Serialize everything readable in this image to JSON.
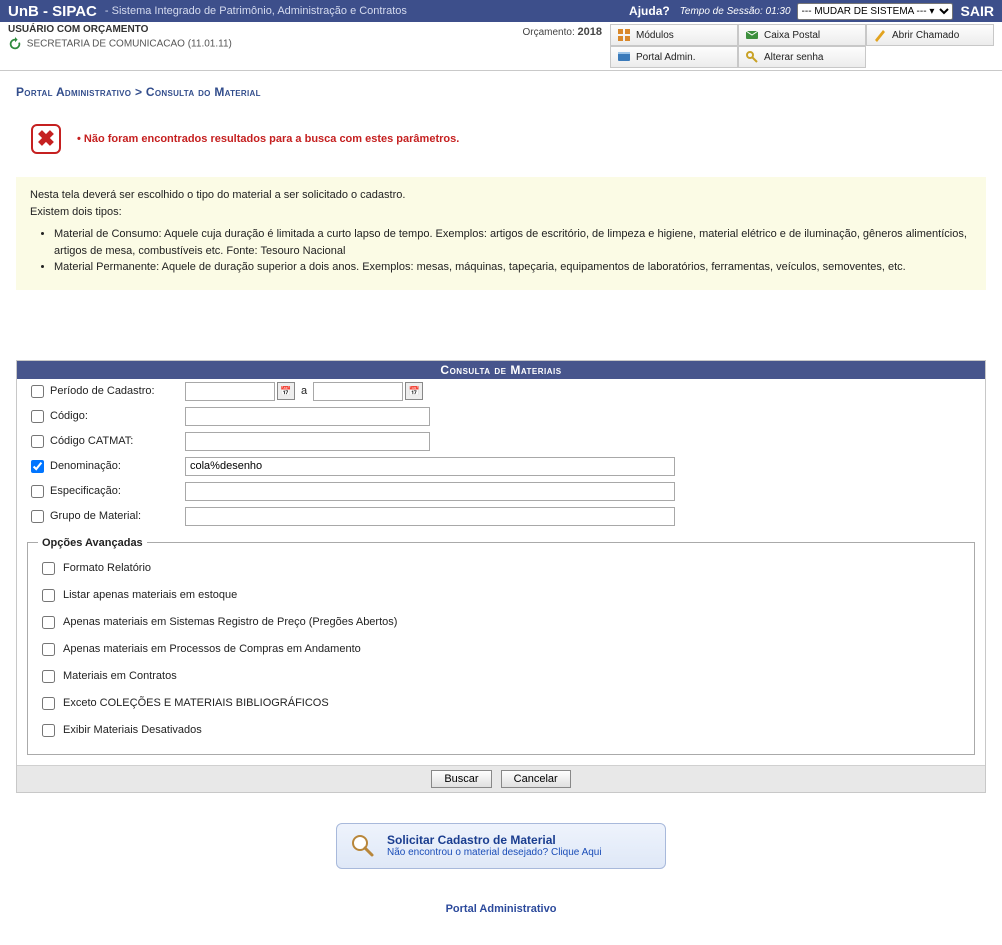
{
  "topbar": {
    "brand": "UnB - SIPAC",
    "subtitle": "- Sistema Integrado de Patrimônio, Administração e Contratos",
    "help": "Ajuda?",
    "session_label": "Tempo de Sessão:",
    "session_time": "01:30",
    "system_select": "--- MUDAR DE SISTEMA --- ▾",
    "logout": "SAIR"
  },
  "subheader": {
    "user_line": "USUÁRIO COM ORÇAMENTO",
    "dept": "SECRETARIA DE COMUNICACAO (11.01.11)",
    "orcamento_label": "Orçamento:",
    "orcamento_year": "2018"
  },
  "shortcuts": {
    "modulos": "Módulos",
    "caixa": "Caixa Postal",
    "chamado": "Abrir Chamado",
    "portal": "Portal Admin.",
    "senha": "Alterar senha"
  },
  "breadcrumb": "Portal Administrativo > Consulta do Material",
  "alert": "Não foram encontrados resultados para a busca com estes parâmetros.",
  "info": {
    "p1": "Nesta tela deverá ser escolhido o tipo do material a ser solicitado o cadastro.",
    "p2": "Existem dois tipos:",
    "li1": "Material de Consumo: Aquele cuja duração é limitada a curto lapso de tempo. Exemplos: artigos de escritório, de limpeza e higiene, material elétrico e de iluminação, gêneros alimentícios, artigos de mesa, combustíveis etc. Fonte: Tesouro Nacional",
    "li2": "Material Permanente: Aquele de duração superior a dois anos. Exemplos: mesas, máquinas, tapeçaria, equipamentos de laboratórios, ferramentas, veículos, semoventes, etc."
  },
  "panel": {
    "title": "Consulta de Materiais",
    "labels": {
      "periodo": "Período de Cadastro:",
      "codigo": "Código:",
      "catmat": "Código CATMAT:",
      "denom": "Denominação:",
      "espec": "Especificação:",
      "grupo": "Grupo de Material:",
      "date_sep": "a"
    },
    "values": {
      "periodo_from": "",
      "periodo_to": "",
      "codigo": "",
      "catmat": "",
      "denom": "cola%desenho",
      "espec": "",
      "grupo": ""
    },
    "adv_legend": "Opções Avançadas",
    "adv": {
      "a1": "Formato Relatório",
      "a2": "Listar apenas materiais em estoque",
      "a3": "Apenas materiais em Sistemas Registro de Preço (Pregões Abertos)",
      "a4": "Apenas materiais em Processos de Compras em Andamento",
      "a5": "Materiais em Contratos",
      "a6": "Exceto COLEÇÕES E MATERIAIS BIBLIOGRÁFICOS",
      "a7": "Exibir Materiais Desativados"
    },
    "buttons": {
      "buscar": "Buscar",
      "cancelar": "Cancelar"
    }
  },
  "solicit": {
    "title": "Solicitar Cadastro de Material",
    "sub": "Não encontrou o material desejado? Clique Aqui"
  },
  "footer": "Portal Administrativo"
}
